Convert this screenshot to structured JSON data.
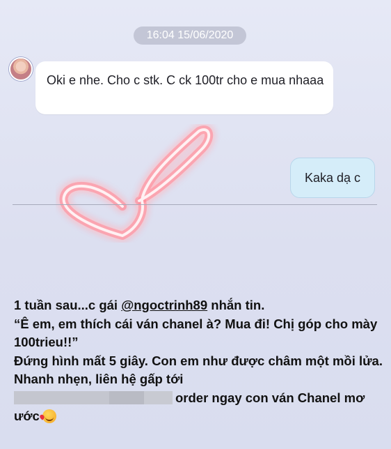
{
  "chat": {
    "timestamp": "16:04 15/06/2020",
    "incoming_message": "Oki e nhe. Cho c stk. C ck 100tr cho e mua nhaaa",
    "outgoing_message": "Kaka dạ c"
  },
  "decoration": {
    "neon_color": "#ff8a98"
  },
  "caption": {
    "line1_prefix": "1 tuần sau...c gái ",
    "line1_mention": "@ngoctrinh89",
    "line1_suffix": " nhắn tin.",
    "quote": "“Ê em, em thích cái ván chanel à? Mua đi! Chị góp cho mày 100trieu!!”",
    "line3": "Đứng hình mất 5 giây. Con em như được châm một mồi lửa. Nhanh nhẹn, liên hệ gấp tới",
    "line4": "order ngay con ván Chanel mơ ước",
    "emoji_icon": "smiling-face-with-hearts-emoji"
  }
}
